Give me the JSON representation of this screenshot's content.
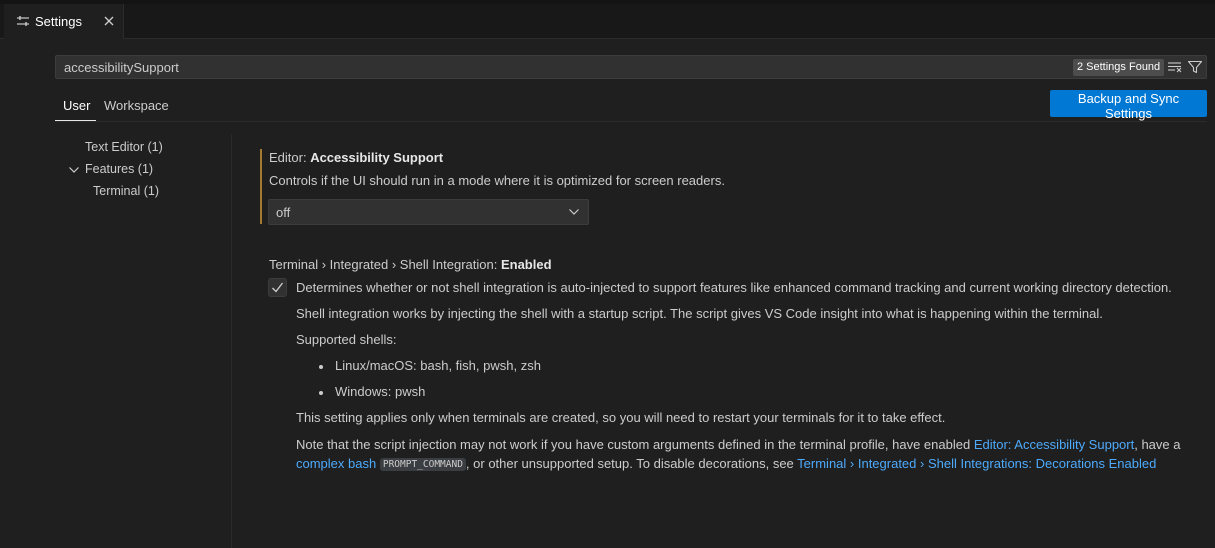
{
  "tab": {
    "label": "Settings"
  },
  "search": {
    "value": "accessibilitySupport",
    "result_count": "2 Settings Found"
  },
  "scopes": {
    "user": "User",
    "workspace": "Workspace"
  },
  "sync_button": "Backup and Sync Settings",
  "toc": {
    "text_editor": "Text Editor (1)",
    "features": "Features (1)",
    "terminal": "Terminal (1)"
  },
  "setting1": {
    "category": "Editor: ",
    "name": "Accessibility Support",
    "description": "Controls if the UI should run in a mode where it is optimized for screen readers.",
    "selected_value": "off"
  },
  "setting2": {
    "category": "Terminal › Integrated › Shell Integration: ",
    "name": "Enabled",
    "checked": true,
    "description": "Determines whether or not shell integration is auto-injected to support features like enhanced command tracking and current working directory detection.",
    "p1": "Shell integration works by injecting the shell with a startup script. The script gives VS Code insight into what is happening within the terminal.",
    "p2": "Supported shells:",
    "shells": [
      "Linux/macOS: bash, fish, pwsh, zsh",
      "Windows: pwsh"
    ],
    "p3": "This setting applies only when terminals are created, so you will need to restart your terminals for it to take effect.",
    "note_part1": "Note that the script injection may not work if you have custom arguments defined in the terminal profile, have enabled ",
    "note_link1": "Editor: Accessibility Support",
    "note_part2": ", have a",
    "note_link2": "complex bash",
    "note_code": "PROMPT_COMMAND",
    "note_part3": ", or other unsupported setup. To disable decorations, see ",
    "note_link3": "Terminal › Integrated › Shell Integrations: Decorations Enabled"
  },
  "colors": {
    "accent": "#0078d4",
    "link": "#4daafc",
    "modified_bar": "#a37a30",
    "background": "#1f1f1f"
  }
}
